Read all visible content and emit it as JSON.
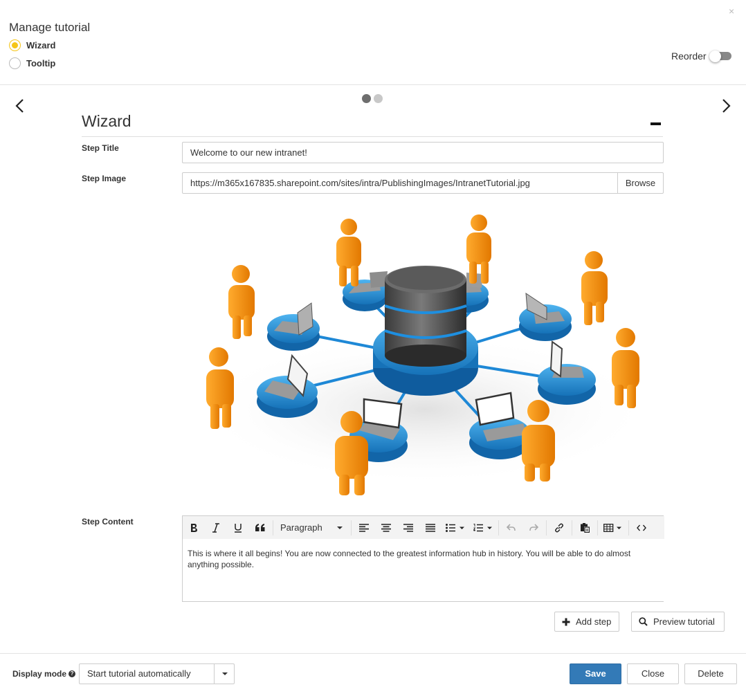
{
  "dialog": {
    "title": "Manage tutorial",
    "close_glyph": "×",
    "mode_options": [
      {
        "label": "Wizard",
        "selected": true
      },
      {
        "label": "Tooltip",
        "selected": false
      }
    ],
    "reorder_label": "Reorder",
    "reorder_enabled": false
  },
  "carousel": {
    "page_count": 2,
    "current_page": 1
  },
  "step": {
    "section_title": "Wizard",
    "title_label": "Step Title",
    "title_value": "Welcome to our new intranet!",
    "image_label": "Step Image",
    "image_url": "https://m365x167835.sharepoint.com/sites/intra/PublishingImages/IntranetTutorial.jpg",
    "browse_label": "Browse",
    "content_label": "Step Content",
    "content_text": "This is where it all begins! You are now connected to the greatest information hub in history. You will be able to do almost anything possible."
  },
  "editor_toolbar": {
    "format_value": "Paragraph",
    "icons": [
      "bold-icon",
      "italic-icon",
      "underline-icon",
      "blockquote-icon",
      "align-left-icon",
      "align-center-icon",
      "align-right-icon",
      "align-justify-icon",
      "bullet-list-icon",
      "numbered-list-icon",
      "undo-icon",
      "redo-icon",
      "link-icon",
      "paste-icon",
      "table-icon",
      "code-icon"
    ]
  },
  "actions": {
    "add_step": "Add step",
    "preview": "Preview tutorial"
  },
  "footer": {
    "display_mode_label": "Display mode",
    "display_mode_value": "Start tutorial automatically",
    "save": "Save",
    "close": "Close",
    "delete": "Delete"
  },
  "colors": {
    "accent_radio": "#f5c518",
    "primary_button": "#337ab7",
    "figure_orange": "#f08a00",
    "node_blue": "#1e90d8"
  }
}
